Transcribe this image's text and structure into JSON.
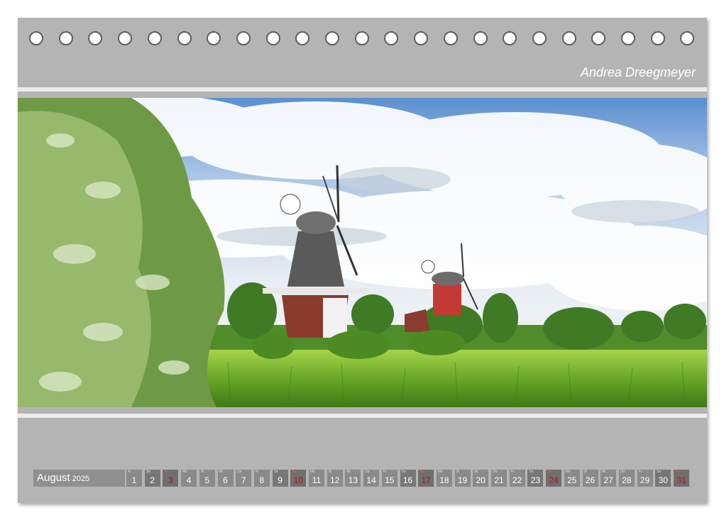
{
  "author": "Andrea Dreegmeyer",
  "calendar": {
    "month": "August",
    "year": "2025",
    "days": [
      {
        "wd": "Fr",
        "d": "1"
      },
      {
        "wd": "Sa",
        "d": "2"
      },
      {
        "wd": "So",
        "d": "3"
      },
      {
        "wd": "Mo",
        "d": "4"
      },
      {
        "wd": "Di",
        "d": "5"
      },
      {
        "wd": "Mi",
        "d": "6"
      },
      {
        "wd": "Do",
        "d": "7"
      },
      {
        "wd": "Fr",
        "d": "8"
      },
      {
        "wd": "Sa",
        "d": "9"
      },
      {
        "wd": "So",
        "d": "10"
      },
      {
        "wd": "Mo",
        "d": "11"
      },
      {
        "wd": "Di",
        "d": "12"
      },
      {
        "wd": "Mi",
        "d": "13"
      },
      {
        "wd": "Do",
        "d": "14"
      },
      {
        "wd": "Fr",
        "d": "15"
      },
      {
        "wd": "Sa",
        "d": "16"
      },
      {
        "wd": "So",
        "d": "17"
      },
      {
        "wd": "Mo",
        "d": "18"
      },
      {
        "wd": "Di",
        "d": "19"
      },
      {
        "wd": "Mi",
        "d": "20"
      },
      {
        "wd": "Do",
        "d": "21"
      },
      {
        "wd": "Fr",
        "d": "22"
      },
      {
        "wd": "Sa",
        "d": "23"
      },
      {
        "wd": "So",
        "d": "24"
      },
      {
        "wd": "Mo",
        "d": "25"
      },
      {
        "wd": "Di",
        "d": "26"
      },
      {
        "wd": "Mi",
        "d": "27"
      },
      {
        "wd": "Do",
        "d": "28"
      },
      {
        "wd": "Fr",
        "d": "29"
      },
      {
        "wd": "Sa",
        "d": "30"
      },
      {
        "wd": "So",
        "d": "31"
      }
    ]
  },
  "colors": {
    "frame": "#b4b4b4",
    "sunday": "#b41616"
  }
}
